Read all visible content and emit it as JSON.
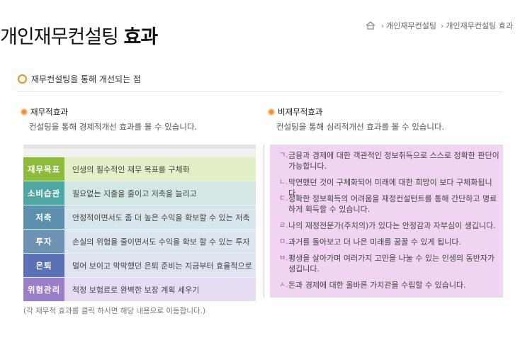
{
  "page": {
    "title_main": "개인재무컨설팅",
    "title_bold": "효과"
  },
  "breadcrumb": {
    "items": [
      "개인재무컨설팅",
      "개인재무컨설팅 효과"
    ]
  },
  "section": {
    "heading": "재무컨설팅을 통해 개선되는 점"
  },
  "financial": {
    "heading": "재무적효과",
    "desc": "컨설팅을 통해 경제적개선 효과를 볼 수 있습니다.",
    "rows": [
      {
        "label": "재무목표",
        "text": "인생의 필수적인 재무 목표를 구체화",
        "label_color": "#8dbb3a",
        "bg": "#e3efc6"
      },
      {
        "label": "소비습관",
        "text": "필요없는 지출을 줄이고 저축을 늘리고",
        "label_color": "#4fa6a3",
        "bg": "#d3e8e4"
      },
      {
        "label": "저축",
        "text": "안정적이면서도 좀 더 높은 수익을 확보할 수 있는 저축",
        "label_color": "#5d8fae",
        "bg": "#d9e5ec"
      },
      {
        "label": "투자",
        "text": "손실의 위험을 줄이면서도 수익을 확보 할 수 있는 투자",
        "label_color": "#6e92b4",
        "bg": "#dde6ef"
      },
      {
        "label": "은퇴",
        "text": "멀어 보이고 막막했던 은퇴 준비는 지금부터 효율적으로",
        "label_color": "#5c70b6",
        "bg": "#dfe3f0"
      },
      {
        "label": "위험관리",
        "text": "적정 보험료로 완벽한 보장 계획 세우기",
        "label_color": "#9a7fc6",
        "bg": "#e6ddf4"
      }
    ]
  },
  "nonfinancial": {
    "heading": "비재무적효과",
    "desc": "컨설팅을 통해 심리적개선 효과를 볼 수 있습니다.",
    "items": [
      {
        "marker": "ㄱ.",
        "text": "금융과 경제에 대한 객관적인 정보취득으로 스스로 정확한 판단이 가능합니다."
      },
      {
        "marker": "ㄴ.",
        "text": "막연했던 것이 구체화되어 미래에 대한 희망이 보다 구체화됩니다."
      },
      {
        "marker": "ㄷ.",
        "text": "정확한 정보획득의 어려움을 재정컨설턴트를 통해 간단하고 명료하게 획득할 수 있습니다."
      },
      {
        "marker": "ㄹ.",
        "text": "나의 재정전문가(주치의)가 있다는 안정감과 자부심이 생깁니다."
      },
      {
        "marker": "ㅁ.",
        "text": "과거를 돌아보고 더 나은 미래를 꿈꿀 수 있게 됩니다."
      },
      {
        "marker": "ㅂ.",
        "text": "평생을 살아가며 여러가지 고민을 나눌 수 있는 인생의 동반자가 생깁니다."
      },
      {
        "marker": "ㅅ.",
        "text": "돈과 경제에 대한 올바른 가치관을 수립할 수 있습니다."
      }
    ]
  },
  "note": "(각 재무적 효과를 클릭 하시면 해당 내용으로 이동합니다.)",
  "icons": {
    "home": "home-icon"
  }
}
